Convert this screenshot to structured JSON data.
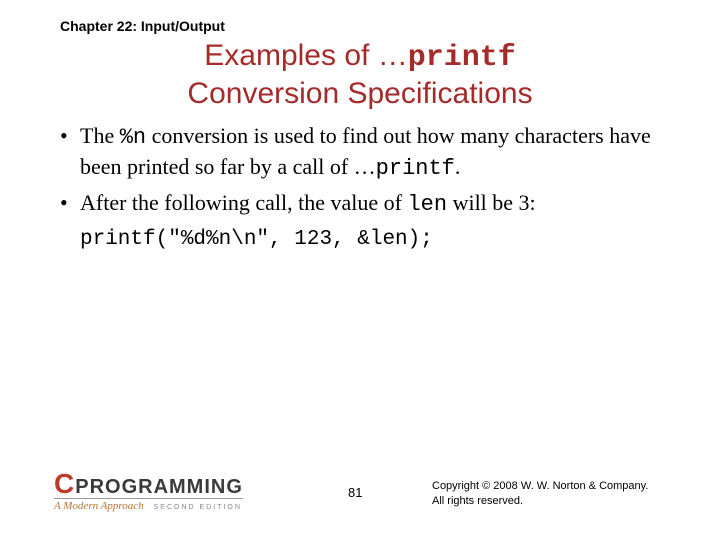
{
  "chapter": "Chapter 22: Input/Output",
  "title": {
    "line1_prefix": "Examples of ",
    "line1_dots": "…",
    "line1_code": "printf",
    "line2": "Conversion Specifications"
  },
  "bullets": [
    {
      "pre": "The ",
      "code1": "%n",
      "mid": " conversion is used to find out how many characters have been printed so far by a call of ",
      "dots": "…",
      "code2": "printf",
      "post": "."
    },
    {
      "pre": "After the following call, the value of ",
      "code1": "len",
      "mid": " will be 3:",
      "dots": "",
      "code2": "",
      "post": ""
    }
  ],
  "code_example": "printf(\"%d%n\\n\", 123, &len);",
  "logo": {
    "c": "C",
    "prog": "PROGRAMMING",
    "sub": "A Modern Approach",
    "ed": "SECOND EDITION"
  },
  "page_number": "81",
  "copyright": {
    "line1": "Copyright © 2008 W. W. Norton & Company.",
    "line2": "All rights reserved."
  }
}
